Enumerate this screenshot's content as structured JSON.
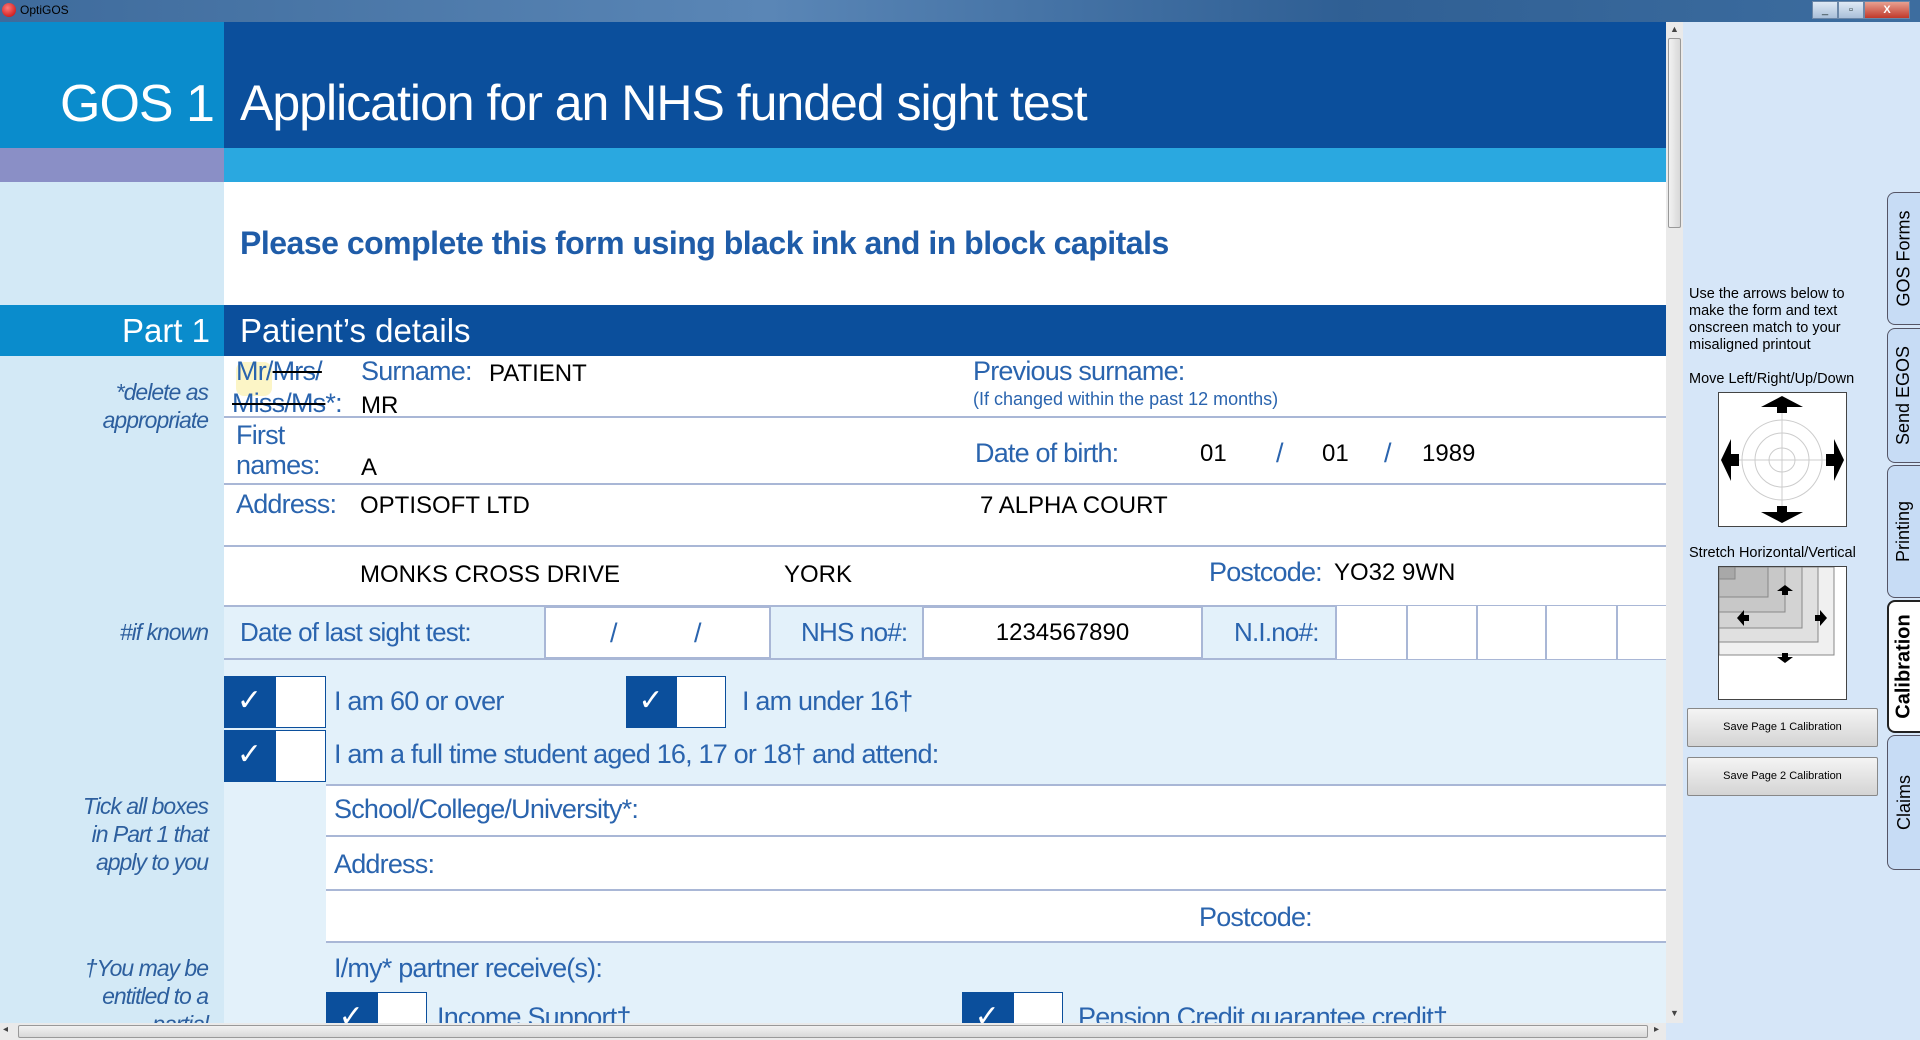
{
  "window": {
    "title": "OptiGOS",
    "controls": [
      "minimize",
      "restore",
      "close"
    ]
  },
  "header": {
    "form_code": "GOS 1",
    "title": "Application for an NHS funded sight test",
    "instruction": "Please complete this form using black ink and in block capitals"
  },
  "part1": {
    "part_label": "Part 1",
    "section_title": "Patient’s details",
    "title_options": {
      "mr": "Mr/",
      "mrs": "Mrs/",
      "miss_ms": "Miss/Ms",
      "suffix": "*:"
    },
    "title_value": "MR",
    "surname_label": "Surname:",
    "surname": "PATIENT",
    "previous_surname_label": "Previous surname:",
    "previous_surname_hint": "(If changed within the past 12 months)",
    "first_label_1": "First",
    "first_label_2": "names:",
    "first_names": "A",
    "dob_label": "Date of birth:",
    "dob_day": "01",
    "dob_month": "01",
    "dob_year": "1989",
    "date_sep": "/",
    "address_label": "Address:",
    "address_line1": "OPTISOFT LTD",
    "address_line2": "7 ALPHA COURT",
    "address_line3": "MONKS CROSS DRIVE",
    "address_line4": "YORK",
    "postcode_label": "Postcode:",
    "postcode": "YO32 9WN",
    "last_test_label": "Date of last sight test:",
    "last_test_value": "",
    "nhs_label": "NHS no#:",
    "nhs_no": "1234567890",
    "ni_label": "N.I.no#:",
    "ni_no": "",
    "checks": {
      "over60": {
        "label": "I am 60 or over",
        "checked": true
      },
      "under16": {
        "label": "I am under 16†",
        "checked": true
      },
      "student": {
        "label": "I am a full time student aged 16, 17 or 18† and attend:",
        "checked": true
      }
    },
    "school_label": "School/College/University*:",
    "school_address_label": "Address:",
    "school_postcode_label": "Postcode:",
    "receives_label": "I/my* partner receive(s):",
    "benefits": [
      {
        "label": "Income Support†",
        "checked": true
      },
      {
        "label": "Pension Credit guarantee credit†",
        "checked": true
      }
    ],
    "check_mark": "✓"
  },
  "notes": {
    "delete": "*delete as appropriate",
    "if_known": "#if known",
    "tick_all": "Tick all boxes in Part 1 that apply to you",
    "entitled": "†You may be entitled to a partial"
  },
  "calibration": {
    "instructions": "Use the arrows below to make the form and text onscreen match to your misaligned printout",
    "move_label": "Move Left/Right/Up/Down",
    "stretch_label": "Stretch Horizontal/Vertical",
    "save1": "Save Page 1 Calibration",
    "save2": "Save Page 2 Calibration"
  },
  "tabs": [
    {
      "label": "GOS Forms"
    },
    {
      "label": "Send EGOS"
    },
    {
      "label": "Printing"
    },
    {
      "label": "Calibration",
      "active": true
    },
    {
      "label": "Claims"
    }
  ],
  "colors": {
    "dark_blue": "#0b4f9c",
    "mid_blue": "#0a8ccc",
    "cyan": "#2aa8e0",
    "pale_blue": "#d3e9f6"
  }
}
